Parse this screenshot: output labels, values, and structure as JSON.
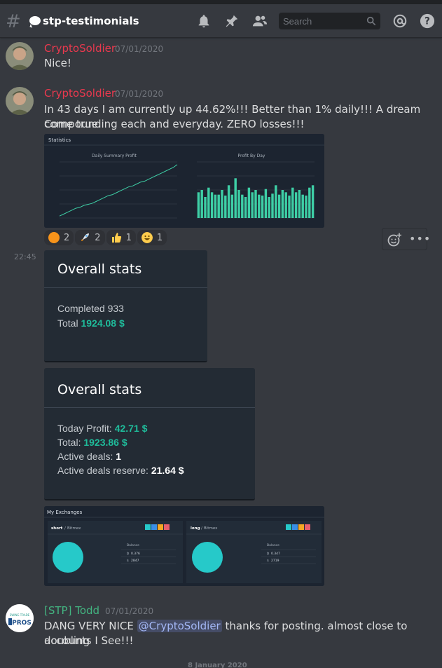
{
  "channel": {
    "name": "stp-testimonials"
  },
  "search": {
    "placeholder": "Search"
  },
  "messages": [
    {
      "author": "CryptoSoldier",
      "author_color": "#e9394e",
      "timestamp": "07/01/2020",
      "text": "Nice!"
    },
    {
      "author": "CryptoSoldier",
      "author_color": "#e9394e",
      "timestamp": "07/01/2020",
      "text_line1": "In 43 days I am currently up 44.62%!!! Better than 1% daily!!! A dream come true.",
      "text_line2": "Compounding each and everyday. ZERO losses!!!"
    }
  ],
  "statistics_image": {
    "title": "Statistics",
    "chart1_title": "Daily Summary Profit",
    "chart2_title": "Profit By Day",
    "chart_data": [
      {
        "type": "line",
        "title": "Daily Summary Profit",
        "values": [
          2,
          4,
          6,
          8,
          10,
          11,
          13,
          14,
          15,
          17,
          19,
          21,
          23,
          24,
          26,
          28,
          30,
          32,
          33,
          35,
          37,
          38,
          40,
          42,
          44,
          46,
          48,
          50,
          52,
          55
        ]
      },
      {
        "type": "bar",
        "title": "Profit By Day",
        "values": [
          55,
          60,
          45,
          65,
          55,
          50,
          50,
          60,
          48,
          70,
          50,
          85,
          60,
          50,
          45,
          65,
          55,
          60,
          50,
          48,
          62,
          45,
          52,
          70,
          50,
          60,
          55,
          48,
          65,
          55,
          60,
          50,
          48,
          65,
          70
        ]
      }
    ]
  },
  "reactions": [
    {
      "emoji": "bitcoin",
      "count": "2",
      "color": "#f7931a"
    },
    {
      "emoji": "rocket",
      "count": "2",
      "color": "#dfe3e8"
    },
    {
      "emoji": "thumbs-up",
      "count": "1",
      "color": "#ffcc4d"
    },
    {
      "emoji": "grinning",
      "count": "1",
      "color": "#ffcc4d"
    }
  ],
  "side_timestamp": "22:45",
  "stats_card_1": {
    "title": "Overall stats",
    "completed_label": "Completed 933",
    "total_label": "Total",
    "total_value": "1924.08 $"
  },
  "stats_card_2": {
    "title": "Overall stats",
    "today_profit_label": "Today Profit:",
    "today_profit_value": "42.71 $",
    "total_label": "Total:",
    "total_value": "1923.86 $",
    "active_deals_label": "Active deals:",
    "active_deals_value": "1",
    "reserve_label": "Active deals reserve:",
    "reserve_value": "21.64 $"
  },
  "exchanges_image": {
    "title": "My Exchanges",
    "left": {
      "name": "short",
      "exchange": "Bitmex",
      "balance_label": "Balance",
      "btc": "0.376",
      "usd": "2847"
    },
    "right": {
      "name": "long",
      "exchange": "Bitmex",
      "balance_label": "Balance",
      "btc": "0.347",
      "usd": "2719"
    },
    "accent": "#26c9c9"
  },
  "todd_message": {
    "author": "[STP] Todd",
    "author_color": "#43b581",
    "timestamp": "07/01/2020",
    "text_before": "DANG VERY NICE",
    "mention": "@CryptoSoldier",
    "text_after": "thanks for posting. almost close to doubling",
    "text_line2": "accounts I See!!!",
    "avatar_text_top": "SWING TRADE",
    "avatar_text_bottom": "PROS"
  },
  "date_separator": "8 January 2020"
}
